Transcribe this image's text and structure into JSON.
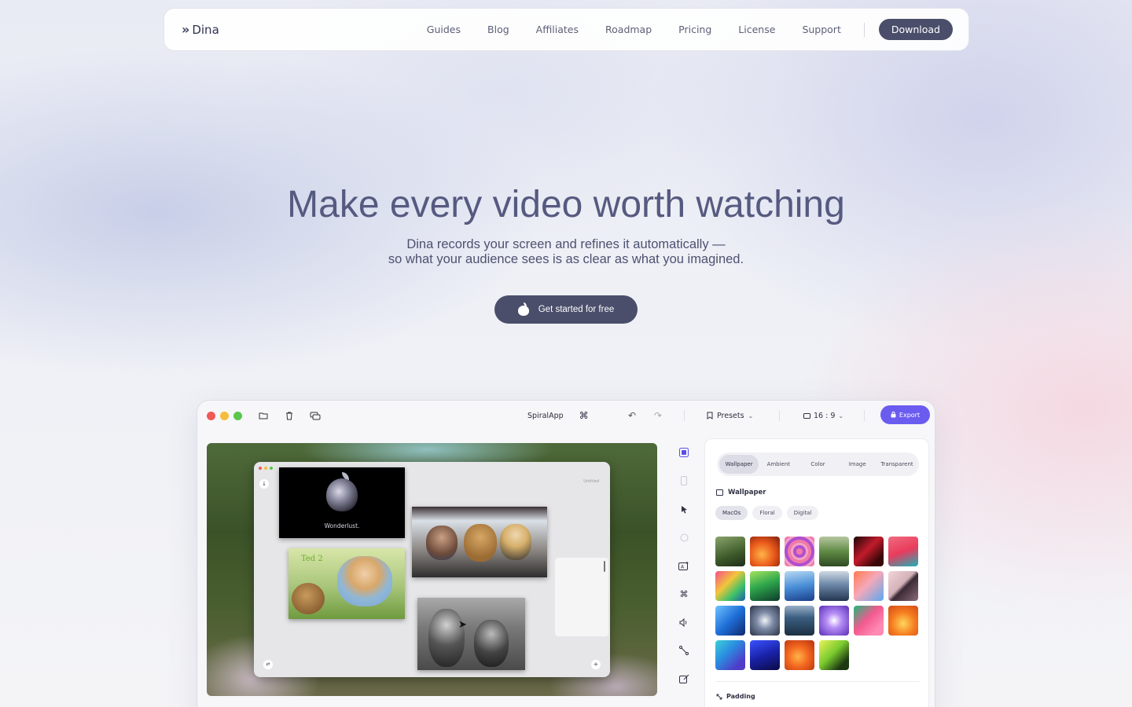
{
  "nav": {
    "brand_icon": "»",
    "brand": "Dina",
    "links": [
      "Guides",
      "Blog",
      "Affiliates",
      "Roadmap",
      "Pricing",
      "License",
      "Support"
    ],
    "download": "Download"
  },
  "hero": {
    "title": "Make every video worth watching",
    "subtitle_line1": "Dina records your screen and refines it automatically —",
    "subtitle_line2": "so what your audience sees is as clear as what you imagined.",
    "cta": "Get started for free"
  },
  "app": {
    "project": "SpiralApp",
    "cmd_glyph": "⌘",
    "presets": "Presets",
    "ratio": "16 : 9",
    "export": "Export",
    "canvas": {
      "untitled": "Untitled",
      "clip1_text": "Wonderlust.",
      "clip2_text": "Ted 2"
    },
    "panel": {
      "tabs": [
        "Wallpaper",
        "Ambient",
        "Color",
        "Image",
        "Transparent"
      ],
      "active_tab": "Wallpaper",
      "section": "Wallpaper",
      "chips": [
        "MacOs",
        "Floral",
        "Digital"
      ],
      "active_chip": "MacOs",
      "padding": "Padding",
      "swatches": [
        "linear-gradient(160deg,#8aa36a,#3d5a2a 60%,#1f2d1a)",
        "radial-gradient(circle at 40% 60%,#ffb347,#e8571a 50%,#7a1e0c)",
        "repeating-radial-gradient(circle at 50% 50%,#f07aa8 0 4px,#b14fd0 4px 8px,#f2a3c3 8px 11px)",
        "linear-gradient(180deg,#b7c7a0,#5f8a45 50%,#2f4a23)",
        "linear-gradient(135deg,#1a0608,#c21b2b 45%,#3a0709 80%)",
        "linear-gradient(160deg,#f06c7f,#e93b5c 50%,#1cb0b8)",
        "linear-gradient(135deg,#f54d8a,#f2c63a 40%,#3cc16a 70%,#1d5fa8)",
        "linear-gradient(160deg,#a5e35d,#2fa84d 45%,#0d3a2a)",
        "linear-gradient(170deg,#b8d9f2,#4a8fd8 50%,#1a3e8a)",
        "linear-gradient(180deg,#cfd8e2,#6c88a8 45%,#233550)",
        "linear-gradient(135deg,#ff7a4f,#f5a8b8 45%,#5aa8f0)",
        "linear-gradient(135deg,#f2d5d8,#d3b1b9 45%,#3a2a35 55%,#8b6c78)",
        "linear-gradient(135deg,#6fc3ff,#1f6fd8 50%,#10296e)",
        "radial-gradient(circle,#f2f3f6 0%,#7c8aa6 40%,#2b3244 100%)",
        "linear-gradient(180deg,#9ab0c8,#3b5e80 40%,#1c2f42)",
        "radial-gradient(circle,#ffffff 0%,#b68ef5 35%,#5a2db8 100%)",
        "linear-gradient(135deg,#1fb87a,#f35a8f 45%,#ff8ab3 80%)",
        "radial-gradient(circle at 50% 60%,#ffd65a,#f57c1f 50%,#d24a1a)",
        "linear-gradient(135deg,#3ed0d8,#2a8ee0 40%,#4f3cc8 80%)",
        "linear-gradient(160deg,#3a52ff,#1a22a8 50%,#0b0b45)",
        "radial-gradient(circle at 45% 55%,#ffb347,#f2661f 45%,#b3300e)",
        "linear-gradient(135deg,#ecf25a,#7acb2e 45%,#1d3a12 80%)"
      ]
    }
  }
}
